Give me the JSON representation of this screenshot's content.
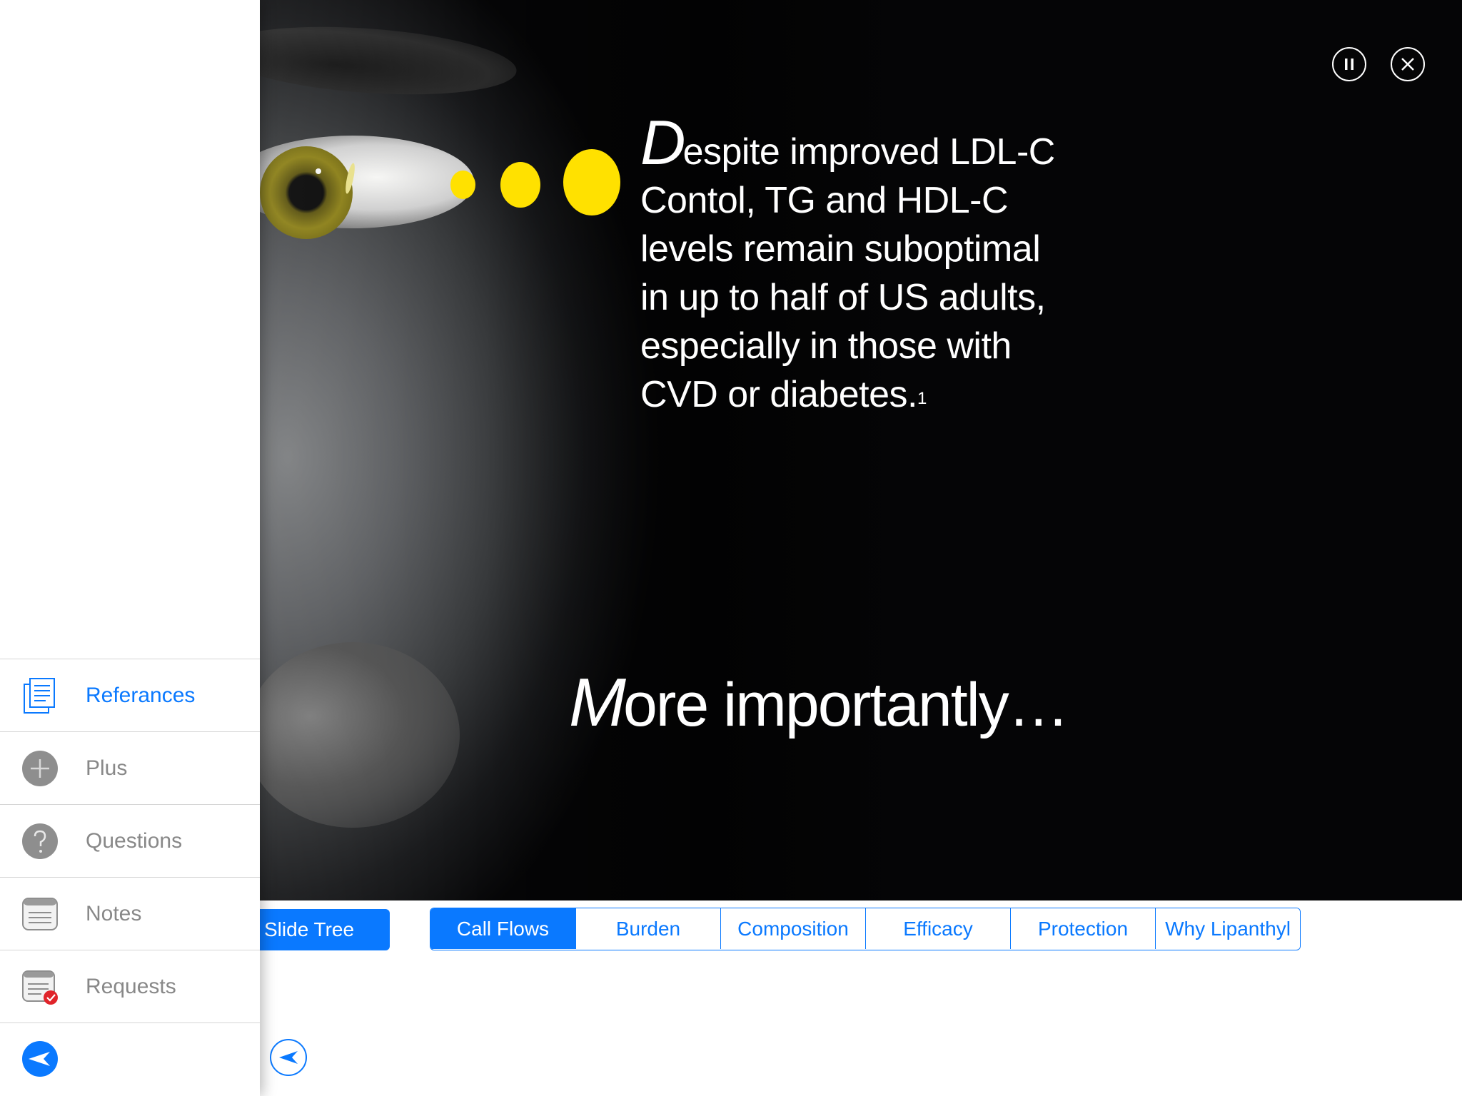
{
  "slide": {
    "headline_cap": "D",
    "headline_rest_line1": "espite improved LDL-C",
    "headline_line2": "Contol, TG and HDL-C",
    "headline_line3": "levels remain suboptimal",
    "headline_line4": "in up to half of US adults,",
    "headline_line5": "especially in those with",
    "headline_line6": "CVD or diabetes.",
    "headline_sup": "1",
    "more_cap": "M",
    "more_rest": "ore importantly…",
    "accent_color": "#ffe100",
    "controls": {
      "pause_icon": "pause-icon",
      "close_icon": "close-icon"
    }
  },
  "tabbar": {
    "slide_tree_label": "Slide Tree",
    "tabs": [
      {
        "label": "Call Flows",
        "active": true
      },
      {
        "label": "Burden",
        "active": false
      },
      {
        "label": "Composition",
        "active": false
      },
      {
        "label": "Efficacy",
        "active": false
      },
      {
        "label": "Protection",
        "active": false
      },
      {
        "label": "Why Lipanthyl",
        "active": false
      }
    ],
    "accent_color": "#0a79ff"
  },
  "menu": {
    "items": [
      {
        "label": "Referances",
        "icon": "document-icon",
        "active": true
      },
      {
        "label": "Plus",
        "icon": "plus-circle-icon",
        "active": false
      },
      {
        "label": "Questions",
        "icon": "question-icon",
        "active": false
      },
      {
        "label": "Notes",
        "icon": "notes-icon",
        "active": false
      },
      {
        "label": "Requests",
        "icon": "requests-icon",
        "active": false
      }
    ],
    "back_icon": "back-arrow-icon"
  }
}
